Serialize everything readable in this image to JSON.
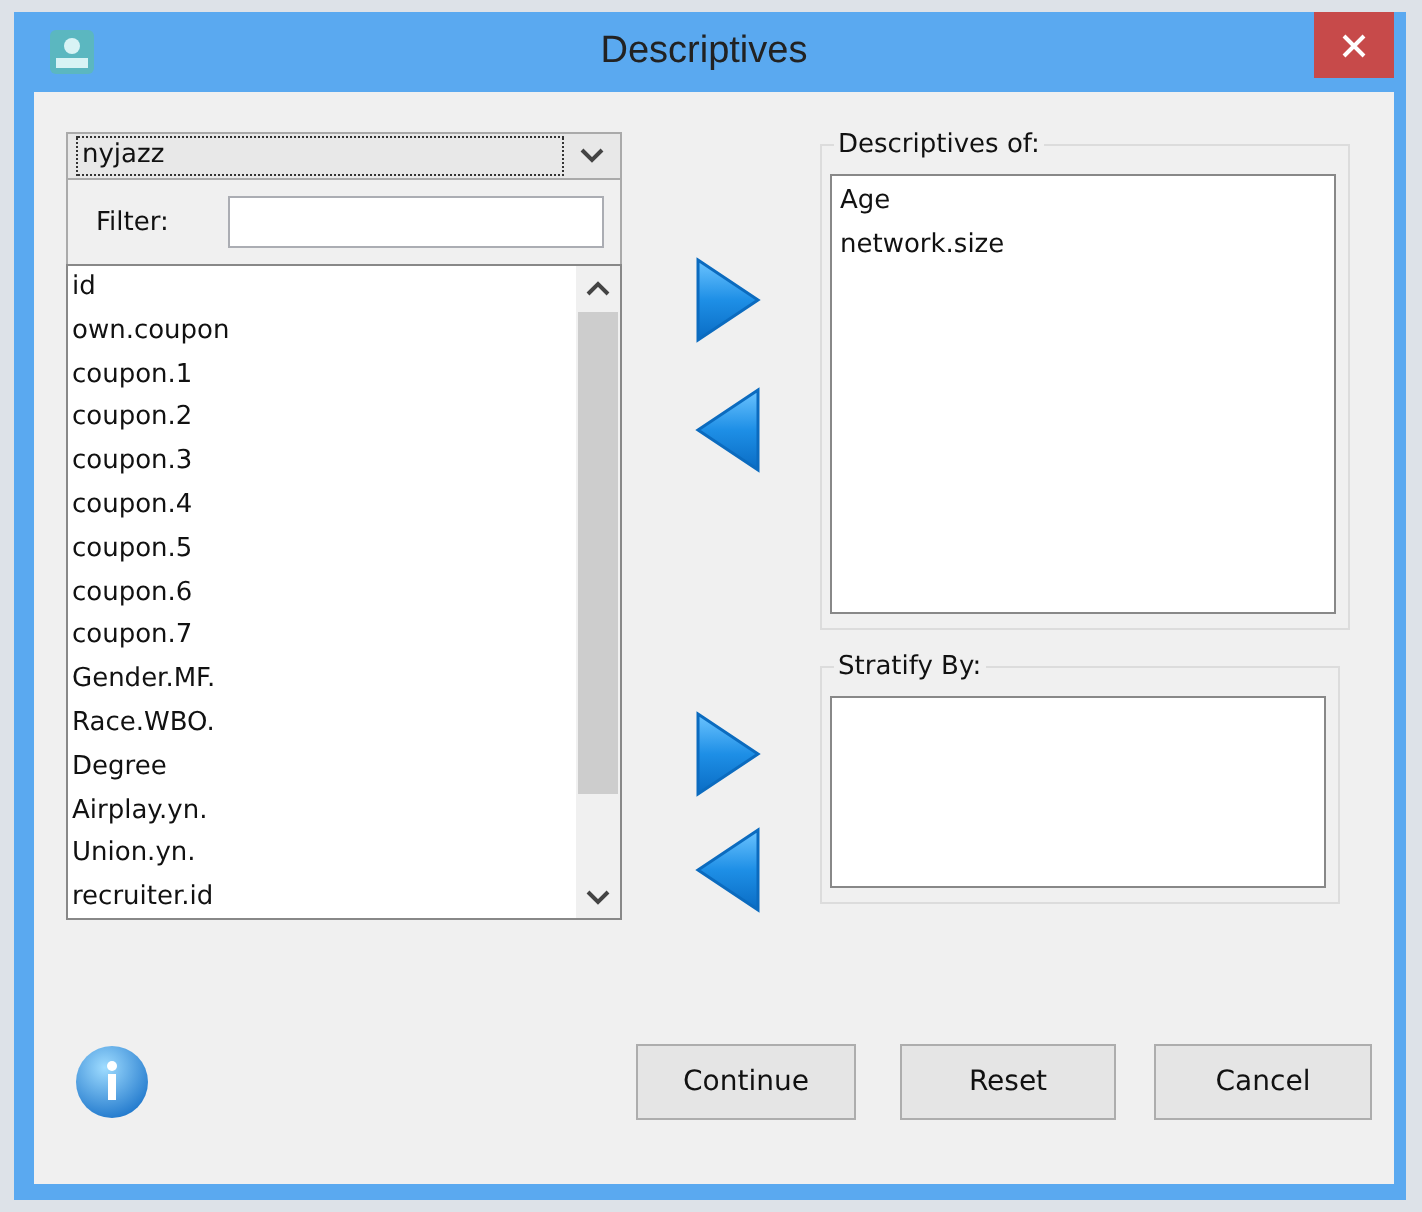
{
  "window": {
    "title": "Descriptives"
  },
  "dataset": {
    "value": "nyjazz"
  },
  "filter": {
    "label": "Filter:"
  },
  "variables": [
    {
      "name": "id"
    },
    {
      "name": "own.coupon"
    },
    {
      "name": "coupon.1"
    },
    {
      "name": "coupon.2"
    },
    {
      "name": "coupon.3"
    },
    {
      "name": "coupon.4"
    },
    {
      "name": "coupon.5"
    },
    {
      "name": "coupon.6"
    },
    {
      "name": "coupon.7"
    },
    {
      "name": "Gender.MF."
    },
    {
      "name": "Race.WBO."
    },
    {
      "name": "Degree"
    },
    {
      "name": "Airplay.yn."
    },
    {
      "name": "Union.yn."
    },
    {
      "name": "recruiter.id"
    }
  ],
  "descriptives_of": {
    "label": "Descriptives of:",
    "items": [
      "Age",
      "network.size"
    ]
  },
  "stratify_by": {
    "label": "Stratify By:"
  },
  "buttons": [
    "Continue",
    "Reset",
    "Cancel"
  ]
}
